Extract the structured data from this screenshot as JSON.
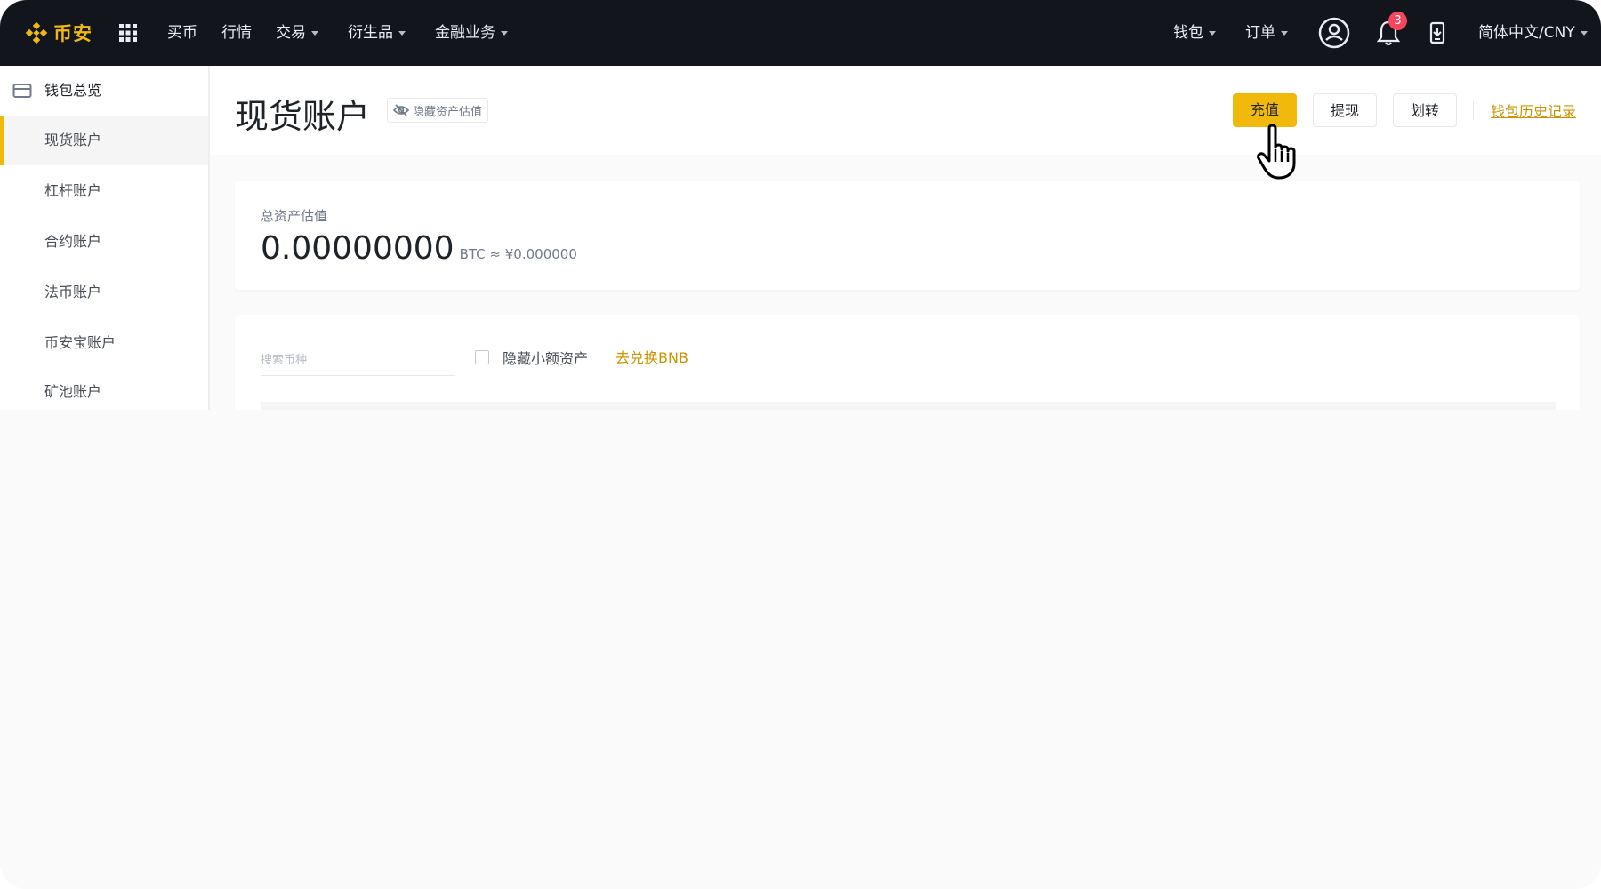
{
  "topnav": {
    "logo_text": "币安",
    "items": [
      {
        "label": "买币",
        "has_caret": false
      },
      {
        "label": "行情",
        "has_caret": false
      },
      {
        "label": "交易",
        "has_caret": true
      },
      {
        "label": "衍生品",
        "has_caret": true
      },
      {
        "label": "金融业务",
        "has_caret": true
      }
    ],
    "right": {
      "wallet": "钱包",
      "orders": "订单",
      "notification_count": "3",
      "language_currency": "简体中文/CNY"
    }
  },
  "sidebar": {
    "items": [
      {
        "label": "钱包总览"
      },
      {
        "label": "现货账户"
      },
      {
        "label": "杠杆账户"
      },
      {
        "label": "合约账户"
      },
      {
        "label": "法币账户"
      },
      {
        "label": "币安宝账户"
      },
      {
        "label": "矿池账户"
      }
    ]
  },
  "header": {
    "title": "现货账户",
    "hide_estimate": "隐藏资产估值",
    "deposit": "充值",
    "withdraw": "提现",
    "transfer": "划转",
    "history": "钱包历史记录"
  },
  "total": {
    "label": "总资产估值",
    "value": "0.00000000",
    "unit": "BTC ≈ ¥0.000000"
  },
  "filters": {
    "search_placeholder": "搜索币种",
    "hide_small": "隐藏小额资产",
    "convert_bnb": "去兑换BNB"
  },
  "colors": {
    "accent": "#f0b90b",
    "nav_bg": "#12161c",
    "link": "#c99400",
    "badge": "#f6465d"
  },
  "icons": {
    "logo": "binance-logo-icon",
    "apps": "grid-icon",
    "account": "user-circle-icon",
    "notifications": "bell-icon",
    "download": "download-app-icon",
    "wallet": "wallet-icon",
    "hide": "eye-slash-icon",
    "cursor": "hand-pointer-icon"
  }
}
